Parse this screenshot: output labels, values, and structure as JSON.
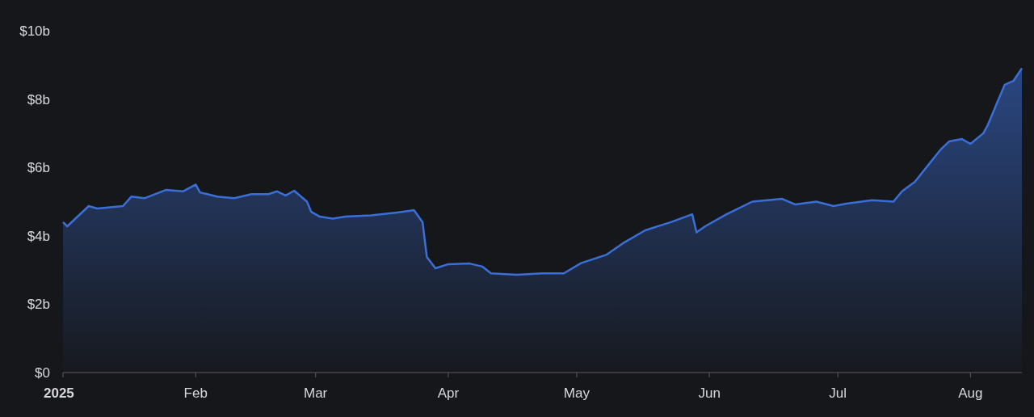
{
  "chart": {
    "chart_data": {
      "type": "area",
      "x": [
        "2025-01-01",
        "2025-01-02",
        "2025-01-07",
        "2025-01-09",
        "2025-01-15",
        "2025-01-17",
        "2025-01-20",
        "2025-01-25",
        "2025-01-29",
        "2025-02-01",
        "2025-02-02",
        "2025-02-06",
        "2025-02-10",
        "2025-02-14",
        "2025-02-18",
        "2025-02-20",
        "2025-02-22",
        "2025-02-24",
        "2025-02-27",
        "2025-02-28",
        "2025-03-02",
        "2025-03-05",
        "2025-03-08",
        "2025-03-14",
        "2025-03-20",
        "2025-03-24",
        "2025-03-26",
        "2025-03-27",
        "2025-03-29",
        "2025-04-01",
        "2025-04-06",
        "2025-04-09",
        "2025-04-11",
        "2025-04-17",
        "2025-04-23",
        "2025-04-28",
        "2025-05-02",
        "2025-05-08",
        "2025-05-12",
        "2025-05-17",
        "2025-05-23",
        "2025-05-28",
        "2025-05-29",
        "2025-05-31",
        "2025-06-05",
        "2025-06-11",
        "2025-06-18",
        "2025-06-21",
        "2025-06-26",
        "2025-06-30",
        "2025-07-03",
        "2025-07-09",
        "2025-07-14",
        "2025-07-16",
        "2025-07-19",
        "2025-07-22",
        "2025-07-25",
        "2025-07-27",
        "2025-07-30",
        "2025-08-01",
        "2025-08-04",
        "2025-08-05",
        "2025-08-07",
        "2025-08-09",
        "2025-08-11",
        "2025-08-13"
      ],
      "series": [
        {
          "color": "#3b6fd8",
          "values": [
            4.4,
            4.28,
            4.87,
            4.8,
            4.87,
            5.15,
            5.1,
            5.34,
            5.3,
            5.5,
            5.27,
            5.15,
            5.1,
            5.22,
            5.22,
            5.3,
            5.18,
            5.32,
            5.0,
            4.7,
            4.56,
            4.5,
            4.56,
            4.6,
            4.68,
            4.75,
            4.4,
            3.38,
            3.05,
            3.17,
            3.19,
            3.1,
            2.9,
            2.86,
            2.9,
            2.9,
            3.2,
            3.45,
            3.8,
            4.16,
            4.4,
            4.63,
            4.1,
            4.28,
            4.63,
            5.0,
            5.08,
            4.92,
            5.0,
            4.87,
            4.94,
            5.04,
            5.0,
            5.3,
            5.58,
            6.05,
            6.52,
            6.76,
            6.83,
            6.69,
            7.0,
            7.23,
            7.83,
            8.42,
            8.53,
            8.9
          ]
        }
      ],
      "xlim": [
        "2025-01-01",
        "2025-08-13"
      ],
      "ylim": [
        0,
        10
      ],
      "xticks": [
        {
          "value": "2025-01-01",
          "label": "2025"
        },
        {
          "value": "2025-02-01",
          "label": "Feb"
        },
        {
          "value": "2025-03-01",
          "label": "Mar"
        },
        {
          "value": "2025-04-01",
          "label": "Apr"
        },
        {
          "value": "2025-05-01",
          "label": "May"
        },
        {
          "value": "2025-06-01",
          "label": "Jun"
        },
        {
          "value": "2025-07-01",
          "label": "Jul"
        },
        {
          "value": "2025-08-01",
          "label": "Aug"
        }
      ],
      "yticks": [
        {
          "value": 0,
          "label": "$0"
        },
        {
          "value": 2,
          "label": "$2b"
        },
        {
          "value": 4,
          "label": "$4b"
        },
        {
          "value": 6,
          "label": "$6b"
        },
        {
          "value": 8,
          "label": "$8b"
        },
        {
          "value": 10,
          "label": "$10b"
        }
      ]
    }
  }
}
